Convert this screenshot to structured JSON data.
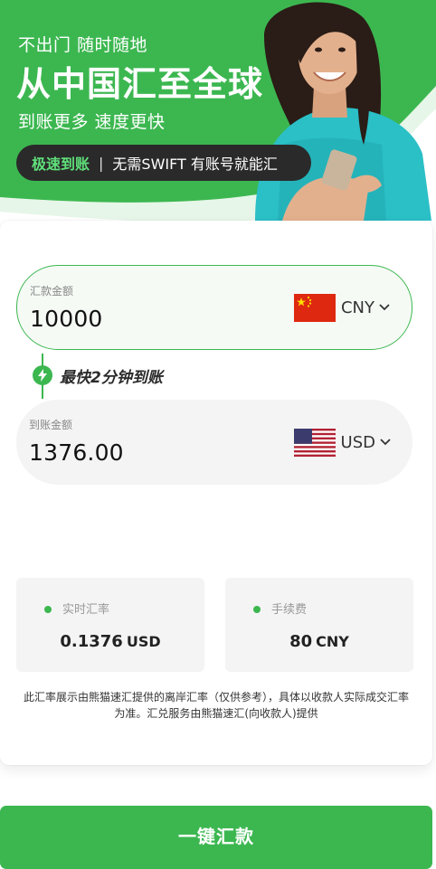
{
  "hero": {
    "line1": "不出门 随时随地",
    "title": "从中国汇至全球",
    "line3": "到账更多 速度更快",
    "pill_highlight": "极速到账",
    "pill_separator": "|",
    "pill_text": "无需SWIFT 有账号就能汇"
  },
  "send": {
    "label": "汇款金额",
    "amount": "10000",
    "currency": "CNY",
    "flag_icon": "china-flag-icon"
  },
  "speed_text": "最快2分钟到账",
  "receive": {
    "label": "到账金额",
    "amount": "1376.00",
    "currency": "USD",
    "flag_icon": "usa-flag-icon"
  },
  "rate": {
    "label": "实时汇率",
    "value": "0.1376",
    "unit": "USD"
  },
  "fee": {
    "label": "手续费",
    "value": "80",
    "unit": "CNY"
  },
  "note": "此汇率展示由熊猫速汇提供的离岸汇率（仅供参考），具体以收款人实际成交汇率为准。汇兑服务由熊猫速汇(向收款人)提供",
  "cta_label": "一键汇款",
  "colors": {
    "brand_green": "#3cb750",
    "pill_bg": "#2a2a2a",
    "pill_highlight": "#5fe07a"
  }
}
